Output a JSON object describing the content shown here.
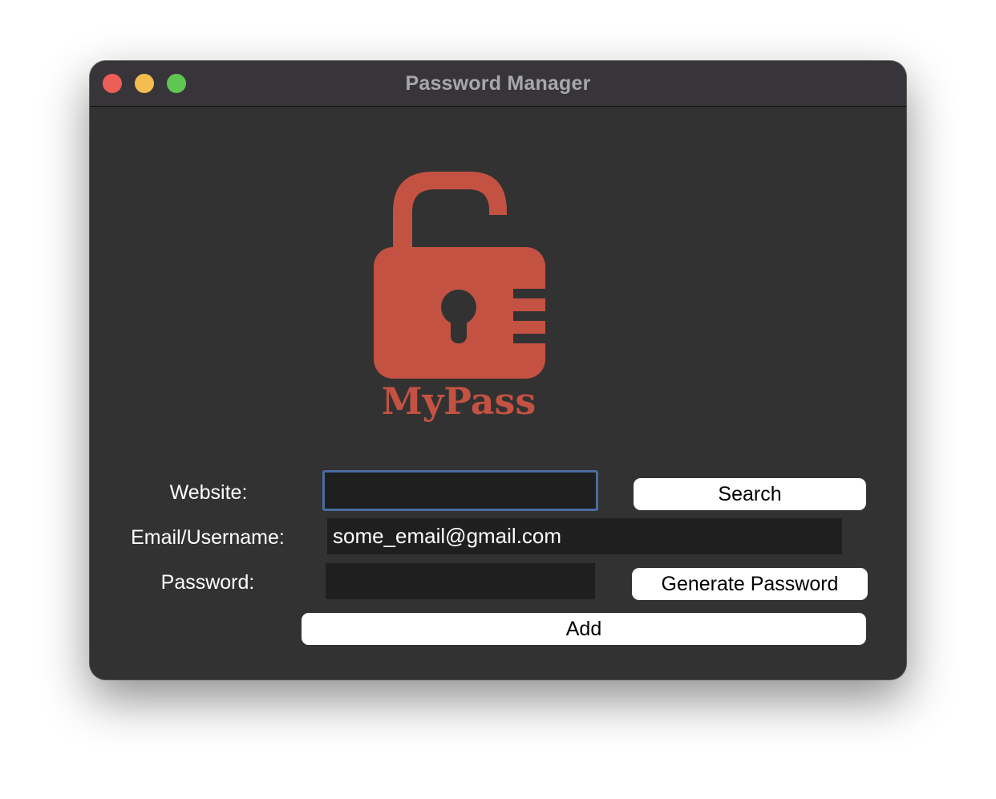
{
  "window": {
    "title": "Password Manager"
  },
  "logo": {
    "text": "MyPass",
    "icon": "open-padlock-icon",
    "color": "#c45242"
  },
  "form": {
    "website_label": "Website:",
    "website_value": "",
    "email_label": "Email/Username:",
    "email_value": "some_email@gmail.com",
    "password_label": "Password:",
    "password_value": ""
  },
  "buttons": {
    "search": "Search",
    "generate": "Generate Password",
    "add": "Add"
  },
  "colors": {
    "background": "#323232",
    "field": "#1f1f1f",
    "focus_ring": "#4a6c9f",
    "close": "#ec5f57",
    "minimize": "#f5bd4f",
    "maximize": "#61c554"
  }
}
